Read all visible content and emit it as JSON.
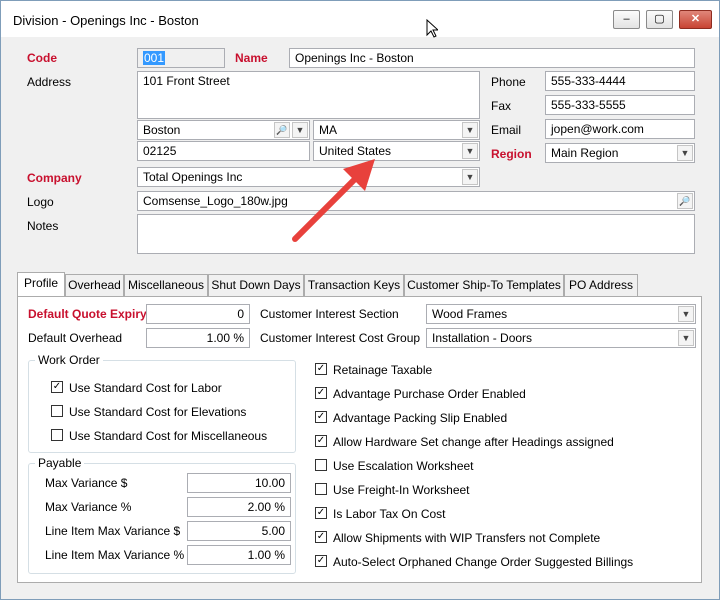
{
  "window": {
    "title": "Division - Openings Inc - Boston",
    "minimize": "–",
    "maximize": "▢",
    "close": "✕"
  },
  "header": {
    "code_label": "Code",
    "code_value": "001",
    "name_label": "Name",
    "name_value": "Openings Inc - Boston",
    "address_label": "Address",
    "address_value": "101 Front Street",
    "city_value": "Boston",
    "state_value": "MA",
    "zip_value": "02125",
    "country_value": "United States",
    "phone_label": "Phone",
    "phone_value": "555-333-4444",
    "fax_label": "Fax",
    "fax_value": "555-333-5555",
    "email_label": "Email",
    "email_value": "jopen@work.com",
    "region_label": "Region",
    "region_value": "Main Region",
    "company_label": "Company",
    "company_value": "Total Openings Inc",
    "logo_label": "Logo",
    "logo_value": "Comsense_Logo_180w.jpg",
    "notes_label": "Notes",
    "notes_value": ""
  },
  "tabs": [
    "Profile",
    "Overhead",
    "Miscellaneous",
    "Shut Down Days",
    "Transaction Keys",
    "Customer Ship-To Templates",
    "PO Address"
  ],
  "profile": {
    "default_quote_expiry_label": "Default Quote Expiry",
    "default_quote_expiry_value": "0",
    "default_overhead_label": "Default Overhead",
    "default_overhead_value": "1.00 %",
    "cust_interest_section_label": "Customer Interest Section",
    "cust_interest_section_value": "Wood Frames",
    "cust_interest_cost_group_label": "Customer Interest Cost Group",
    "cust_interest_cost_group_value": "Installation - Doors",
    "work_order": {
      "title": "Work Order",
      "items": [
        {
          "label": "Use Standard Cost for Labor",
          "checked": true
        },
        {
          "label": "Use Standard Cost for Elevations",
          "checked": false
        },
        {
          "label": "Use Standard Cost for Miscellaneous",
          "checked": false
        }
      ]
    },
    "payable": {
      "title": "Payable",
      "rows": [
        {
          "label": "Max Variance $",
          "value": "10.00"
        },
        {
          "label": "Max Variance %",
          "value": "2.00 %"
        },
        {
          "label": "Line Item Max Variance $",
          "value": "5.00"
        },
        {
          "label": "Line Item Max Variance %",
          "value": "1.00 %"
        }
      ]
    },
    "options": [
      {
        "label": "Retainage Taxable",
        "checked": true
      },
      {
        "label": "Advantage Purchase Order Enabled",
        "checked": true
      },
      {
        "label": "Advantage Packing Slip Enabled",
        "checked": true
      },
      {
        "label": "Allow Hardware Set change after Headings assigned",
        "checked": true
      },
      {
        "label": "Use Escalation Worksheet",
        "checked": false
      },
      {
        "label": "Use Freight-In Worksheet",
        "checked": false
      },
      {
        "label": "Is Labor Tax On Cost",
        "checked": true
      },
      {
        "label": "Allow Shipments with WIP Transfers not Complete",
        "checked": true
      },
      {
        "label": "Auto-Select Orphaned Change Order Suggested Billings",
        "checked": true
      }
    ]
  },
  "icons": {
    "checkmark": "✓",
    "dropdown": "▼",
    "lookup": "🔎"
  },
  "colors": {
    "required": "#c8102e",
    "annotation_arrow": "#e8413c"
  }
}
